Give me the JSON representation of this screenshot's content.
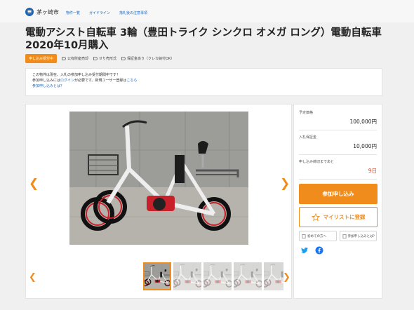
{
  "header": {
    "logo_text": "茅ヶ崎市",
    "nav": [
      "物件一覧",
      "ガイドライン",
      "落札後の注意事項"
    ]
  },
  "item": {
    "title": "電動アシスト自転車 3輪（豊田トライク シンクロ オメガ ロング）電動自転車 2020年10月購入",
    "status_badge": "申し込み受付中",
    "tags": [
      "公有財産売却",
      "せり売形式",
      "保証金あり（クレカ納付OK）"
    ]
  },
  "notice": {
    "line1": "この物件は現在、入札の参加申し込み受付期間中です！",
    "line2_prefix": "参加申し込みには",
    "line2_login": "ログイン",
    "line2_middle": "が必要です。新規ユーザー登録は",
    "line2_here": "こちら",
    "line3": "参加申し込みとは？"
  },
  "sidebar": {
    "rows": [
      {
        "label": "予定価格",
        "value": "100,000円"
      },
      {
        "label": "入札保証金",
        "value": "10,000円"
      },
      {
        "label": "申し込み締切まであと",
        "value": "9日"
      }
    ],
    "join_button": "参加申し込み",
    "mylist_button": "マイリストに登録",
    "first_time_button": "初めての方へ",
    "how_to_join_button": "参加申し込みとは？"
  },
  "icons": {
    "logo": "city-logo-icon",
    "arrows": [
      "chevron-left-icon",
      "chevron-right-icon"
    ],
    "star": "star-outline-icon",
    "social": [
      "twitter-icon",
      "facebook-icon"
    ]
  },
  "colors": {
    "accent": "#f08c1c",
    "link": "#1a66b8",
    "deadline": "#e6462c"
  }
}
